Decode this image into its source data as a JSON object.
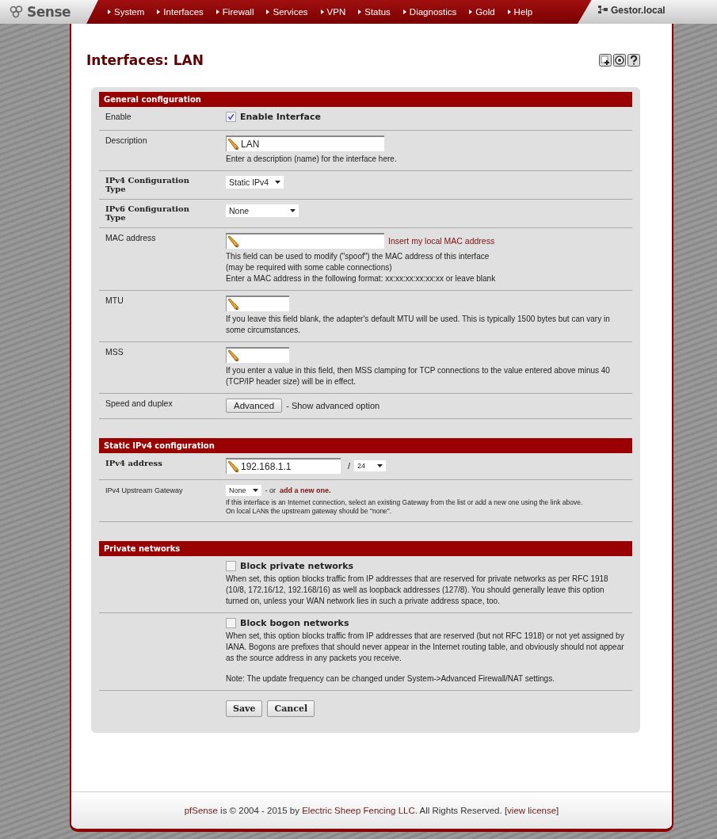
{
  "nav": {
    "logo": "Sense",
    "menu": [
      "System",
      "Interfaces",
      "Firewall",
      "Services",
      "VPN",
      "Status",
      "Diagnostics",
      "Gold",
      "Help"
    ],
    "host": "Gestor.local"
  },
  "page_title": "Interfaces: LAN",
  "sections": [
    {
      "title": "General configuration",
      "rows": [
        {
          "label": "Enable",
          "bold": false,
          "kind": "checkbox",
          "checked": true,
          "text": "Enable Interface"
        },
        {
          "label": "Description",
          "bold": false,
          "kind": "input",
          "value": "LAN",
          "notes": [
            "Enter a description (name) for the interface here."
          ]
        },
        {
          "label": "IPv4 Configuration Type",
          "bold": true,
          "kind": "select",
          "value": "Static IPv4"
        },
        {
          "label": "IPv6 Configuration Type",
          "bold": true,
          "kind": "wide_select",
          "value": "None"
        },
        {
          "label": "MAC address",
          "bold": false,
          "kind": "input",
          "link": "Insert my local MAC address",
          "notes": [
            "This field can be used to modify (\"spoof\") the MAC address of this interface",
            "(may be required with some cable connections)",
            "Enter a MAC address in the following format: xx:xx:xx:xx:xx:xx or leave blank"
          ]
        },
        {
          "label": "MTU",
          "bold": false,
          "kind": "short_input",
          "notes": [
            "If you leave this field blank, the adapter's default MTU will be used. This is typically 1500 bytes but can vary in some circumstances."
          ]
        },
        {
          "label": "MSS",
          "bold": false,
          "kind": "short_input",
          "notes": [
            "If you enter a value in this field, then MSS clamping for TCP connections to the value entered above minus 40 (TCP/IP header size) will be in effect."
          ]
        },
        {
          "label": "Speed and duplex",
          "bold": false,
          "kind": "button",
          "button": "Advanced",
          "text": "- Show advanced option"
        }
      ]
    },
    {
      "title": "Static IPv4 configuration",
      "rows": [
        {
          "label": "IPv4 address",
          "bold": true,
          "kind": "address",
          "value": "192.168.1.1",
          "separator": "/",
          "mask": "24"
        },
        {
          "label": "IPv4 Upstream Gateway",
          "bold": false,
          "kind": "gateway",
          "value": "None",
          "text": "- or",
          "link": "add a new one.",
          "notes": [
            "If this interface is an Internet connection, select an existing Gateway from the list or add a new one using the link above.",
            "On local LANs the upstream gateway should be \"none\"."
          ]
        }
      ]
    },
    {
      "title": "Private networks",
      "rows": [
        {
          "kind": "checkbox",
          "checked": false,
          "text": "Block private networks",
          "notes": [
            "When set, this option blocks traffic from IP addresses that are reserved for private networks as per RFC 1918 (10/8, 172.16/12, 192.168/16) as well as loopback addresses (127/8).   You should generally leave this option turned on, unless your WAN network lies in such a private address space, too."
          ]
        },
        {
          "kind": "checkbox",
          "checked": false,
          "text": "Block bogon networks",
          "notes": [
            "When set, this option blocks traffic from IP addresses that are reserved (but not RFC 1918) or not yet assigned by IANA.  Bogons are prefixes that should never appear in the Internet routing table, and obviously should not appear as the source address in any packets you receive."
          ],
          "extra_note": "Note: The update frequency can be changed under System->Advanced Firewall/NAT settings."
        }
      ]
    }
  ],
  "buttons": [
    {
      "label": "Save"
    },
    {
      "label": "Cancel"
    }
  ],
  "footer": {
    "brand": "pfSense",
    "text1": "is © 2004 - 2015 by",
    "company": "Electric Sheep Fencing LLC",
    "text2": ". All Rights Reserved. [",
    "license": "view license",
    "text3": "]"
  }
}
